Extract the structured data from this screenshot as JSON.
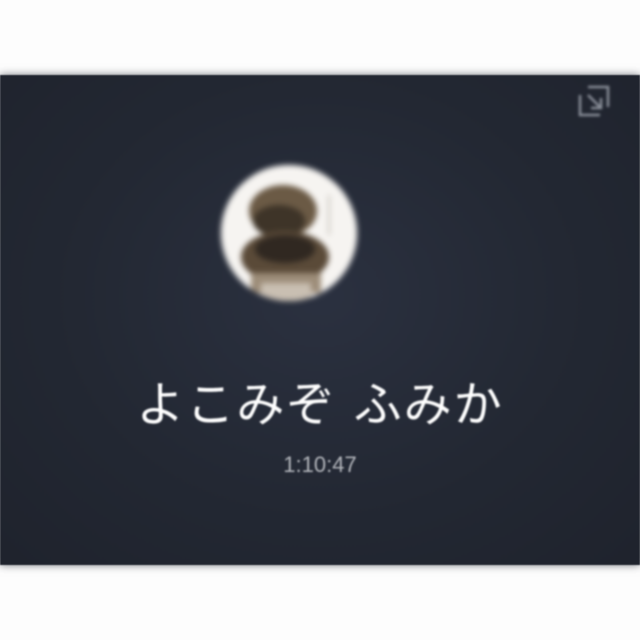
{
  "call": {
    "caller_name": "よこみぞ ふみか",
    "duration": "1:10:47"
  },
  "icons": {
    "minimize": "minimize-arrow-icon"
  },
  "colors": {
    "background": "#242935",
    "name_text": "#ffffff",
    "timer_text": "#b3b6bc"
  }
}
